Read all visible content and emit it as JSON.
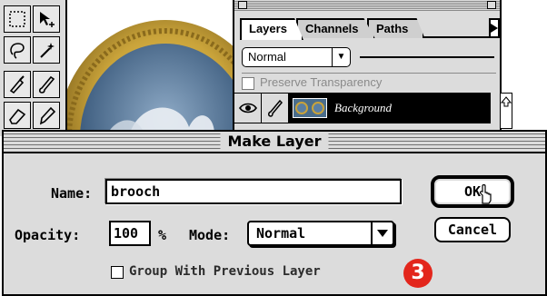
{
  "layers_palette": {
    "tabs": [
      {
        "label": "Layers",
        "active": true
      },
      {
        "label": "Channels",
        "active": false
      },
      {
        "label": "Paths",
        "active": false
      }
    ],
    "blend_mode": "Normal",
    "preserve_transparency_label": "Preserve Transparency",
    "preserve_transparency_checked": false,
    "layer_name": "Background"
  },
  "dialog": {
    "title": "Make Layer",
    "name_label": "Name:",
    "name_value": "brooch",
    "ok_label": "OK",
    "cancel_label": "Cancel",
    "opacity_label": "Opacity:",
    "opacity_value": "100",
    "percent_sign": "%",
    "mode_label": "Mode:",
    "mode_value": "Normal",
    "group_label": "Group With Previous Layer",
    "group_checked": false
  },
  "step_badge": "3",
  "colors": {
    "badge": "#e3261c",
    "photo_sky": "#5b7fa3",
    "gold_frame": "#c9a33a"
  }
}
